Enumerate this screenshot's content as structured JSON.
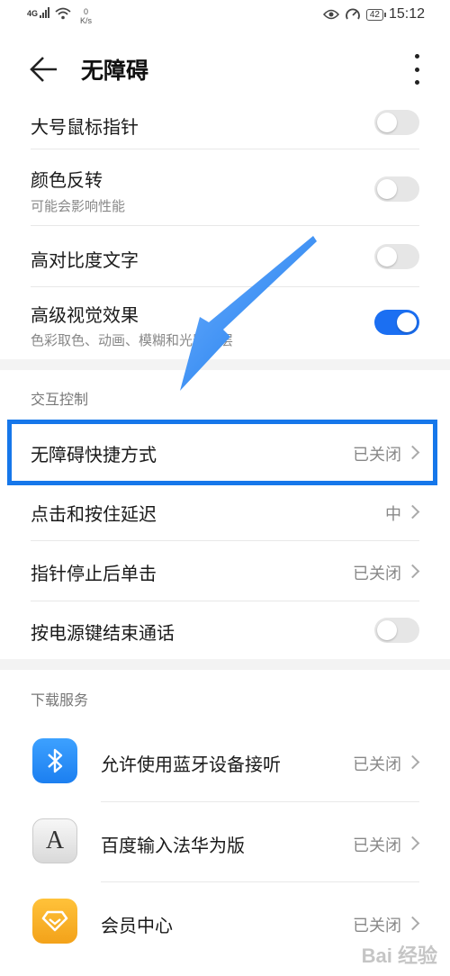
{
  "status_bar": {
    "network": "4G",
    "speed_value": "0",
    "speed_unit": "K/s",
    "battery": "42",
    "time": "15:12"
  },
  "header": {
    "title": "无障碍",
    "back_icon": "arrow-left-icon",
    "more_icon": "more-vertical-icon"
  },
  "display_settings": [
    {
      "label": "大号鼠标指针",
      "toggle_on": false
    },
    {
      "label": "颜色反转",
      "sub": "可能会影响性能",
      "toggle_on": false
    },
    {
      "label": "高对比度文字",
      "toggle_on": false
    },
    {
      "label": "高级视觉效果",
      "sub": "色彩取色、动画、模糊和光影错层",
      "toggle_on": true
    }
  ],
  "interaction": {
    "section_title": "交互控制",
    "items": [
      {
        "label": "无障碍快捷方式",
        "value": "已关闭"
      },
      {
        "label": "点击和按住延迟",
        "value": "中"
      },
      {
        "label": "指针停止后单击",
        "value": "已关闭"
      },
      {
        "label": "按电源键结束通话",
        "toggle_on": false
      }
    ]
  },
  "download": {
    "section_title": "下载服务",
    "items": [
      {
        "label": "允许使用蓝牙设备接听",
        "value": "已关闭",
        "icon": "bluetooth-icon"
      },
      {
        "label": "百度输入法华为版",
        "value": "已关闭",
        "icon": "keyboard-a-icon",
        "icon_text": "A"
      },
      {
        "label": "会员中心",
        "value": "已关闭",
        "icon": "diamond-icon"
      }
    ]
  },
  "colors": {
    "accent": "#1b6ff2",
    "highlight_box": "#1677ea",
    "annotation_arrow": "#1677ea"
  },
  "watermark": "Bai 经验"
}
